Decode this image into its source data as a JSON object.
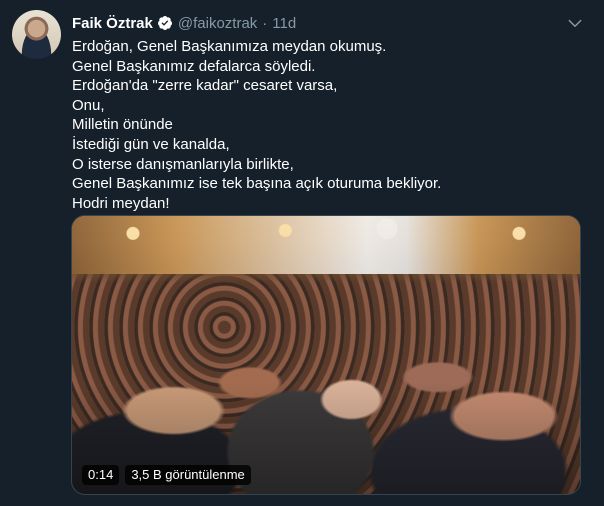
{
  "tweet": {
    "author_name": "Faik Öztrak",
    "author_handle": "@faikoztrak",
    "separator": "·",
    "timestamp": "11d",
    "lines": [
      "Erdoğan, Genel Başkanımıza meydan okumuş.",
      "Genel Başkanımız defalarca söyledi.",
      "Erdoğan'da \"zerre kadar\" cesaret varsa,",
      "Onu,",
      "Milletin önünde",
      "İstediği gün ve kanalda,",
      "O isterse danışmanlarıyla birlikte,",
      "Genel Başkanımız ise tek başına açık oturuma bekliyor.",
      "Hodri meydan!"
    ]
  },
  "video": {
    "duration": "0:14",
    "views": "3,5 B görüntülenme"
  },
  "icons": {
    "verified": "verified-badge-icon",
    "caret": "chevron-down-icon"
  },
  "colors": {
    "background": "#15202b",
    "text_primary": "#ffffff",
    "text_secondary": "#8899a6",
    "verified": "#ffffff"
  }
}
